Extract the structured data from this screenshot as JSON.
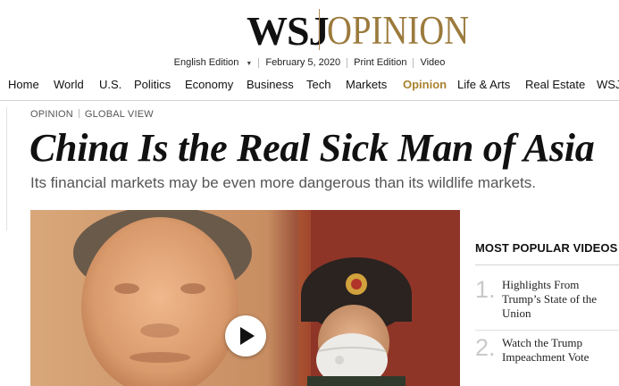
{
  "masthead": {
    "brand": "WSJ",
    "section": "OPINION"
  },
  "edition_bar": {
    "edition": "English Edition",
    "date": "February 5, 2020",
    "print_edition": "Print Edition",
    "video": "Video"
  },
  "nav": {
    "items": [
      {
        "label": "Home"
      },
      {
        "label": "World"
      },
      {
        "label": "U.S."
      },
      {
        "label": "Politics"
      },
      {
        "label": "Economy"
      },
      {
        "label": "Business"
      },
      {
        "label": "Tech"
      },
      {
        "label": "Markets"
      },
      {
        "label": "Opinion",
        "active": true
      },
      {
        "label": "Life & Arts"
      },
      {
        "label": "Real Estate"
      },
      {
        "label": "WSJ"
      }
    ]
  },
  "article": {
    "section": "OPINION",
    "column": "GLOBAL VIEW",
    "headline": "China Is the Real Sick Man of Asia",
    "dek": "Its financial markets may be even more dangerous than its wildlife markets."
  },
  "media": {
    "play_icon": "play-icon"
  },
  "popular_videos": {
    "title": "MOST POPULAR VIDEOS",
    "items": [
      {
        "rank": "1.",
        "title": "Highlights From Trump’s State of the Union"
      },
      {
        "rank": "2.",
        "title": "Watch the Trump Impeachment Vote"
      }
    ]
  },
  "colors": {
    "brand_gold": "#9b7a3c",
    "active_nav": "#a8822f",
    "text": "#111111",
    "muted": "#555555"
  }
}
